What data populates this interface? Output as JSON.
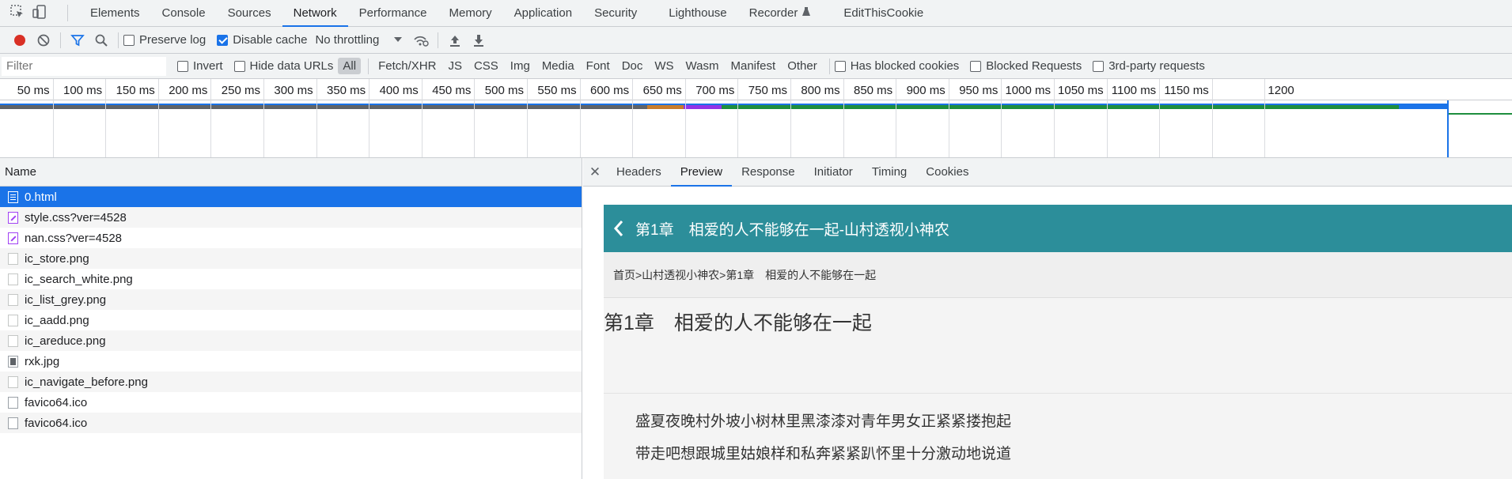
{
  "devtools": {
    "tabs": [
      "Elements",
      "Console",
      "Sources",
      "Network",
      "Performance",
      "Memory",
      "Application",
      "Security",
      "Lighthouse",
      "Recorder",
      "EditThisCookie"
    ],
    "active_tab": "Network"
  },
  "toolbar": {
    "preserve_log": "Preserve log",
    "disable_cache": "Disable cache",
    "disable_cache_checked": true,
    "throttling": "No throttling"
  },
  "filterbar": {
    "placeholder": "Filter",
    "invert": "Invert",
    "hide_data_urls": "Hide data URLs",
    "types": [
      "All",
      "Fetch/XHR",
      "JS",
      "CSS",
      "Img",
      "Media",
      "Font",
      "Doc",
      "WS",
      "Wasm",
      "Manifest",
      "Other"
    ],
    "active_type": "All",
    "has_blocked_cookies": "Has blocked cookies",
    "blocked_requests": "Blocked Requests",
    "third_party": "3rd-party requests"
  },
  "timeline": {
    "ticks": [
      "50 ms",
      "100 ms",
      "150 ms",
      "200 ms",
      "250 ms",
      "300 ms",
      "350 ms",
      "400 ms",
      "450 ms",
      "500 ms",
      "550 ms",
      "600 ms",
      "650 ms",
      "700 ms",
      "750 ms",
      "800 ms",
      "850 ms",
      "900 ms",
      "950 ms",
      "1000 ms",
      "1050 ms",
      "1100 ms",
      "1150 ms",
      "1200"
    ]
  },
  "requests": {
    "header": "Name",
    "items": [
      {
        "name": "0.html",
        "icon": "doc-icon",
        "selected": true
      },
      {
        "name": "style.css?ver=4528",
        "icon": "css-icon"
      },
      {
        "name": "nan.css?ver=4528",
        "icon": "css-icon"
      },
      {
        "name": "ic_store.png",
        "icon": "image-icon"
      },
      {
        "name": "ic_search_white.png",
        "icon": "image-icon"
      },
      {
        "name": "ic_list_grey.png",
        "icon": "image-icon"
      },
      {
        "name": "ic_aadd.png",
        "icon": "image-icon"
      },
      {
        "name": "ic_areduce.png",
        "icon": "image-icon"
      },
      {
        "name": "rxk.jpg",
        "icon": "jpg-icon"
      },
      {
        "name": "ic_navigate_before.png",
        "icon": "image-icon"
      },
      {
        "name": "favico64.ico",
        "icon": "file-icon"
      },
      {
        "name": "favico64.ico",
        "icon": "file-icon"
      }
    ]
  },
  "detail": {
    "tabs": [
      "Headers",
      "Preview",
      "Response",
      "Initiator",
      "Timing",
      "Cookies"
    ],
    "active_tab": "Preview"
  },
  "preview": {
    "header_title": "第1章　相爱的人不能够在一起-山村透视小神农",
    "breadcrumb": "首页>山村透视小神农>第1章　相爱的人不能够在一起",
    "chapter_title": "第1章　相爱的人不能够在一起",
    "paragraphs": [
      "盛夏夜晚村外坡小树林里黑漆漆对青年男女正紧紧搂抱起",
      "带走吧想跟城里姑娘样和私奔紧紧趴怀里十分激动地说道"
    ]
  },
  "colors": {
    "accent": "#1a73e8",
    "preview_header": "#2c8e9a",
    "record": "#d93025"
  }
}
